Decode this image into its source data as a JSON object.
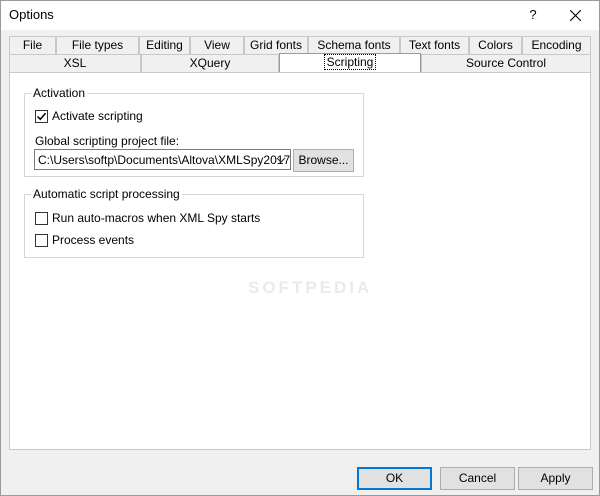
{
  "window": {
    "title": "Options",
    "help_label": "?"
  },
  "tabs": {
    "row1": [
      "File",
      "File types",
      "Editing",
      "View",
      "Grid fonts",
      "Schema fonts",
      "Text fonts",
      "Colors",
      "Encoding"
    ],
    "row2": [
      "XSL",
      "XQuery",
      "Scripting",
      "Source Control"
    ],
    "selected": "Scripting"
  },
  "activation": {
    "title": "Activation",
    "activate_label": "Activate scripting",
    "activate_checked": true,
    "project_file_label": "Global scripting project file:",
    "project_file_value": "C:\\Users\\softp\\Documents\\Altova\\XMLSpy2017",
    "browse_label": "Browse..."
  },
  "auto_script": {
    "title": "Automatic script processing",
    "run_macros_label": "Run auto-macros when XML Spy starts",
    "run_macros_checked": false,
    "process_events_label": "Process events",
    "process_events_checked": false
  },
  "buttons": {
    "ok": "OK",
    "cancel": "Cancel",
    "apply": "Apply"
  },
  "watermark": "SOFTPEDIA"
}
